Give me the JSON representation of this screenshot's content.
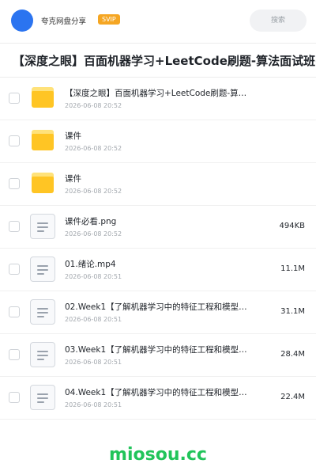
{
  "header": {
    "share_title": "夸克网盘分享",
    "svip_badge": "SVIP",
    "search_placeholder": "搜索"
  },
  "folder": {
    "title": "【深度之眼】百面机器学习+LeetCode刷题-算法面试班-第"
  },
  "files": [
    {
      "type": "folder",
      "name": "【深度之眼】百面机器学习+LeetCode刷题-算…",
      "date": "2026-06-08 20:52",
      "size": ""
    },
    {
      "type": "folder",
      "name": "课件",
      "date": "2026-06-08 20:52",
      "size": ""
    },
    {
      "type": "folder",
      "name": "课件",
      "date": "2026-06-08 20:52",
      "size": ""
    },
    {
      "type": "file",
      "name": "课件必看.png",
      "date": "2026-06-08 20:52",
      "size": "494KB"
    },
    {
      "type": "file",
      "name": "01.绪论.mp4",
      "date": "2026-06-08 20:51",
      "size": "11.1M"
    },
    {
      "type": "file",
      "name": "02.Week1【了解机器学习中的特征工程和模型评…",
      "date": "2026-06-08 20:51",
      "size": "31.1M"
    },
    {
      "type": "file",
      "name": "03.Week1【了解机器学习中的特征工程和模型评…",
      "date": "2026-06-08 20:51",
      "size": "28.4M"
    },
    {
      "type": "file",
      "name": "04.Week1【了解机器学习中的特征工程和模型评…",
      "date": "2026-06-08 20:51",
      "size": "22.4M"
    }
  ],
  "watermark": "miosou.cc",
  "colors": {
    "accent": "#2b74f0",
    "svip": "#f5a623",
    "folder": "#ffc524",
    "watermark": "#21c45a"
  }
}
